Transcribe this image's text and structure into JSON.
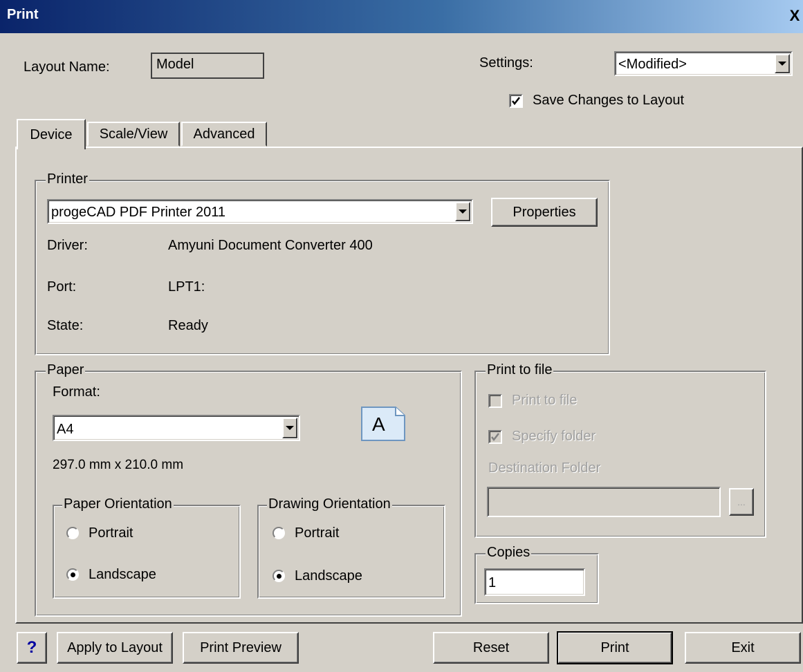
{
  "window": {
    "title": "Print",
    "close": "X"
  },
  "layout": {
    "label": "Layout Name:",
    "value": "Model"
  },
  "settings": {
    "label": "Settings:",
    "selected": "<Modified>"
  },
  "save_changes": {
    "label": "Save Changes to Layout",
    "checked": true
  },
  "tabs": [
    {
      "label": "Device"
    },
    {
      "label": "Scale/View"
    },
    {
      "label": "Advanced"
    }
  ],
  "printer": {
    "group_label": "Printer",
    "selected": "progeCAD PDF Printer 2011",
    "properties_label": "Properties",
    "driver_label": "Driver:",
    "driver": "Amyuni Document Converter 400",
    "port_label": "Port:",
    "port": "LPT1:",
    "state_label": "State:",
    "state": "Ready"
  },
  "paper": {
    "group_label": "Paper",
    "format_label": "Format:",
    "format_selected": "A4",
    "size": "297.0 mm x 210.0 mm",
    "icon_letter": "A",
    "paper_orientation": {
      "label": "Paper Orientation",
      "portrait": "Portrait",
      "landscape": "Landscape",
      "selected": "Landscape"
    },
    "drawing_orientation": {
      "label": "Drawing Orientation",
      "portrait": "Portrait",
      "landscape": "Landscape",
      "selected": "Landscape"
    }
  },
  "print_to_file": {
    "group_label": "Print to file",
    "print_to_file_label": "Print to file",
    "specify_folder_label": "Specify folder",
    "destination_label": "Destination Folder",
    "destination_value": "",
    "browse_label": "..."
  },
  "copies": {
    "label": "Copies",
    "value": "1"
  },
  "footer": {
    "help": "?",
    "apply": "Apply to Layout",
    "preview": "Print Preview",
    "reset": "Reset",
    "print": "Print",
    "exit": "Exit"
  },
  "colors": {
    "help_icon": "#0000a0",
    "titlebar_start": "#0a246a"
  }
}
